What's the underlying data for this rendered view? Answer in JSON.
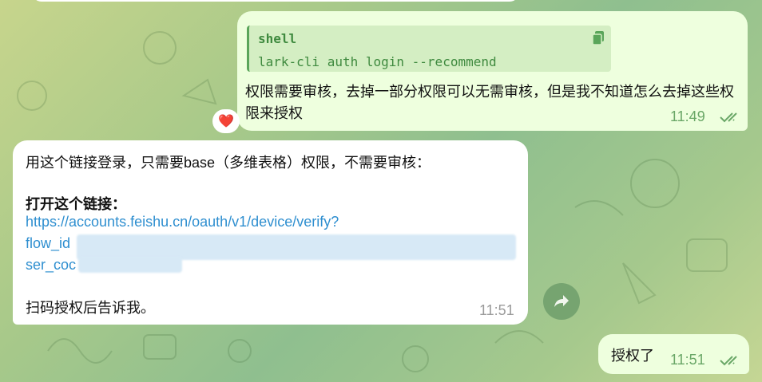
{
  "messages": {
    "outgoing_1": {
      "code_lang": "shell",
      "code": "lark-cli auth login --recommend",
      "text": "权限需要审核，去掉一部分权限可以无需审核，但是我不知道怎么去掉这些权限来授权",
      "time": "11:49",
      "reaction": "❤️"
    },
    "incoming_1": {
      "line1": "用这个链接登录，只需要base（多维表格）权限，不需要审核：",
      "heading": "打开这个链接：",
      "link_line1": "https://accounts.feishu.cn/oauth/v1/device/verify?",
      "link_line2": "flow_id",
      "link_line3": "ser_coc",
      "footer": "扫码授权后告诉我。",
      "time": "11:51"
    },
    "outgoing_2": {
      "text": "授权了",
      "time": "11:51"
    }
  },
  "icons": {
    "copy": "copy-icon",
    "read_receipt": "double-check-icon",
    "share": "share-arrow-icon"
  },
  "colors": {
    "outgoing_bubble": "#eeffde",
    "incoming_bubble": "#ffffff",
    "link": "#2f8fd0",
    "code": "#3f8a3f",
    "time_out": "#6aa767"
  }
}
